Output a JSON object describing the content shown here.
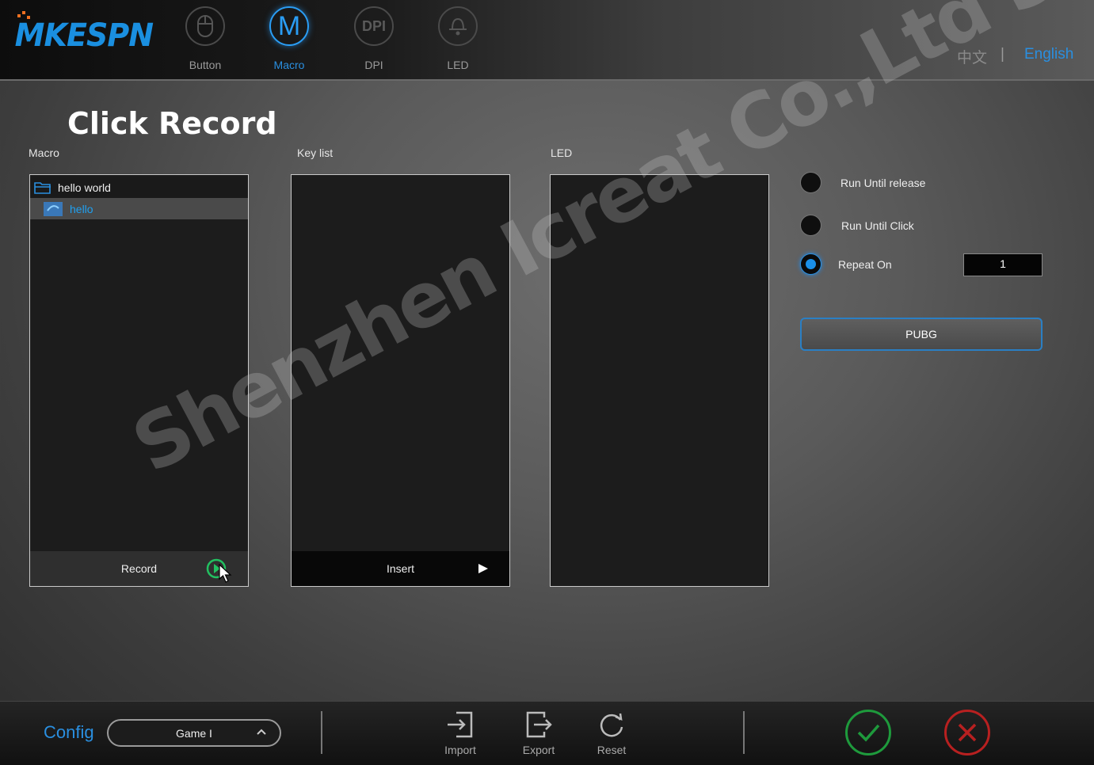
{
  "app": {
    "logo_text": "MKESPN",
    "nav": [
      {
        "label": "Button",
        "icon": "mouse-icon"
      },
      {
        "label": "Macro",
        "icon": "macro-m-icon",
        "glyph": "M"
      },
      {
        "label": "DPI",
        "icon": "dpi-icon",
        "glyph": "DPI"
      },
      {
        "label": "LED",
        "icon": "led-icon"
      }
    ],
    "active_nav": "Macro",
    "languages": {
      "chinese": "中文",
      "separator": "|",
      "english": "English"
    }
  },
  "headline": "Click Record",
  "macro_panel": {
    "label": "Macro",
    "folder_name": "hello world",
    "item_name": "hello",
    "footer_label": "Record"
  },
  "keylist_panel": {
    "label": "Key list",
    "footer_label": "Insert"
  },
  "led_panel": {
    "label": "LED"
  },
  "options": {
    "run_until_release": "Run Until release",
    "run_until_click": "Run Until Click",
    "repeat_on": "Repeat On",
    "selected": "Repeat On",
    "repeat_count": "1",
    "pubg_button": "PUBG"
  },
  "watermark": "Shenzhen Icreat Co.,Ltd Store",
  "footer": {
    "config_label": "Config",
    "game_select": "Game I",
    "import": "Import",
    "export": "Export",
    "reset": "Reset"
  },
  "colors": {
    "accent": "#2a8fe0",
    "ok": "#1e9a3c",
    "cancel": "#b82020",
    "logo_dots": "#f07020"
  }
}
